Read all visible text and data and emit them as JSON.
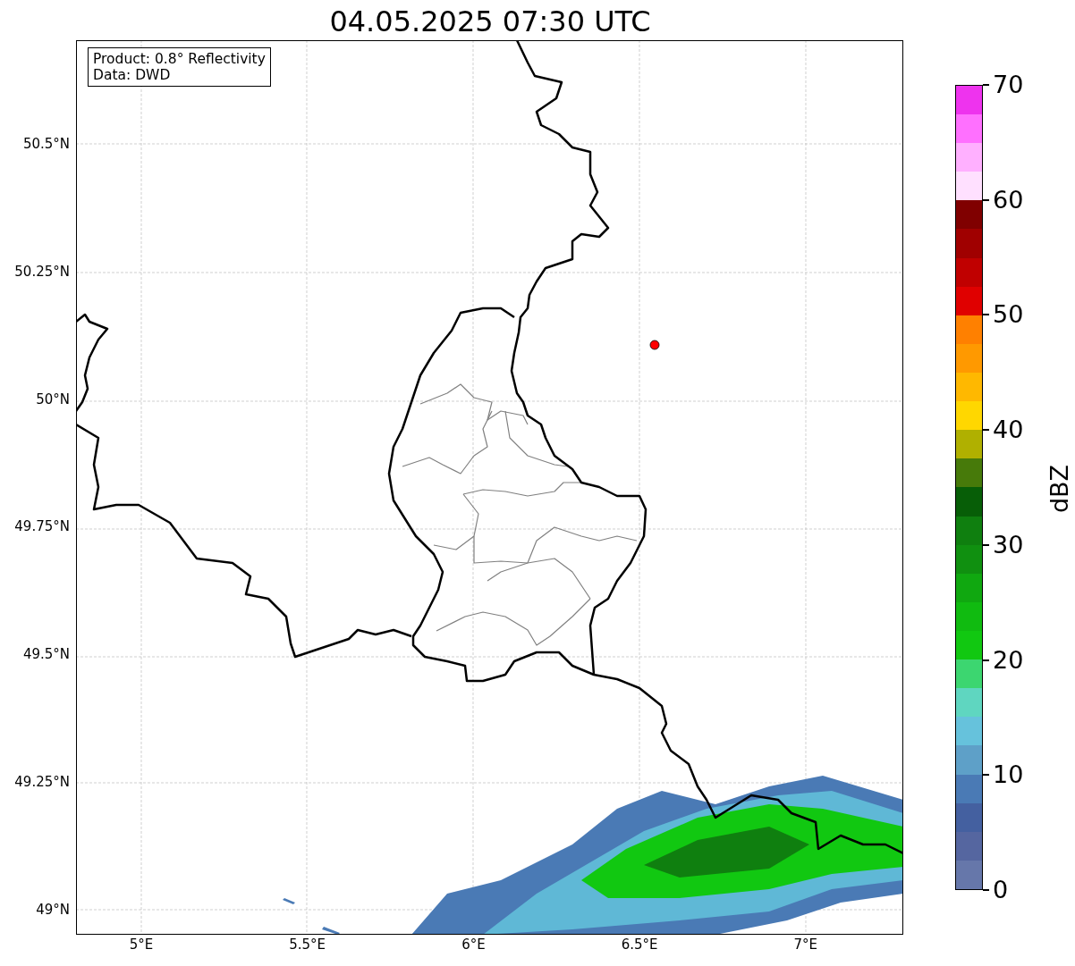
{
  "title": "04.05.2025 07:30 UTC",
  "info_box": [
    "Product: 0.8° Reflectivity",
    "Data: DWD"
  ],
  "map": {
    "lat_labels": [
      "50.5°N",
      "50.25°N",
      "50°N",
      "49.75°N",
      "49.5°N",
      "49.25°N",
      "49°N"
    ],
    "lon_labels": [
      "5°E",
      "5.5°E",
      "6°E",
      "6.5°E",
      "7°E"
    ]
  },
  "colorbar": {
    "label": "dBZ",
    "ticks": [
      "70",
      "60",
      "50",
      "40",
      "30",
      "20",
      "10",
      "0"
    ],
    "bins": [
      {
        "color": "#6677aa"
      },
      {
        "color": "#5566a0"
      },
      {
        "color": "#4460a0"
      },
      {
        "color": "#4a7ab5"
      },
      {
        "color": "#5ea0c8"
      },
      {
        "color": "#66c2dc"
      },
      {
        "color": "#5fd6c0"
      },
      {
        "color": "#3cd670"
      },
      {
        "color": "#11c811"
      },
      {
        "color": "#10bb10"
      },
      {
        "color": "#10a810"
      },
      {
        "color": "#109010"
      },
      {
        "color": "#0f7f0f"
      },
      {
        "color": "#075e07"
      },
      {
        "color": "#477a0a"
      },
      {
        "color": "#b0b000"
      },
      {
        "color": "#ffd700"
      },
      {
        "color": "#ffb800"
      },
      {
        "color": "#ff9900"
      },
      {
        "color": "#ff8000"
      },
      {
        "color": "#e00000"
      },
      {
        "color": "#c00000"
      },
      {
        "color": "#a00000"
      },
      {
        "color": "#800000"
      },
      {
        "color": "#ffe0ff"
      },
      {
        "color": "#ffb0ff"
      },
      {
        "color": "#ff70ff"
      },
      {
        "color": "#ee33ee"
      }
    ]
  }
}
